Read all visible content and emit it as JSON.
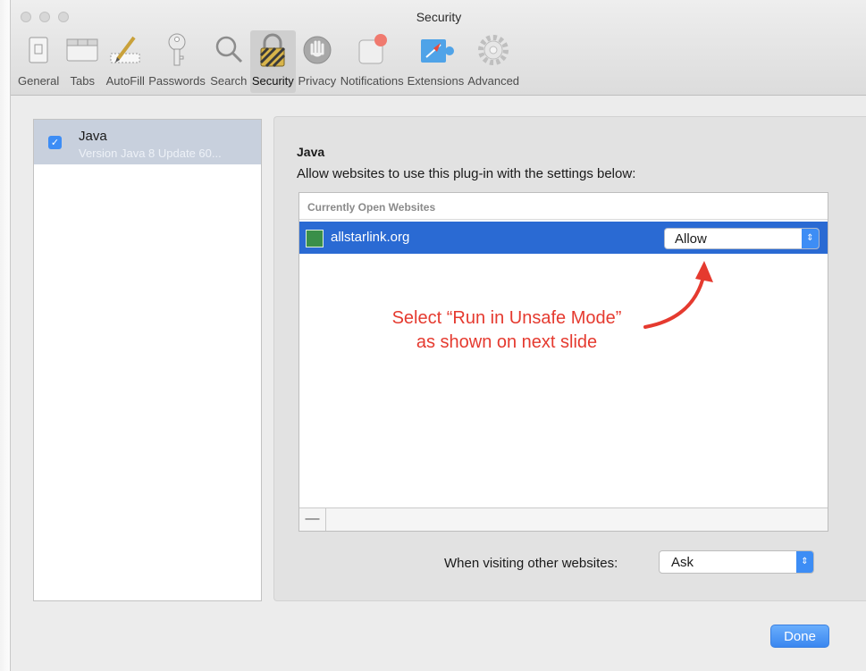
{
  "window": {
    "title": "Security"
  },
  "toolbar": {
    "tabs": [
      {
        "label": "General",
        "icon": "general-icon"
      },
      {
        "label": "Tabs",
        "icon": "tabs-icon"
      },
      {
        "label": "AutoFill",
        "icon": "autofill-icon"
      },
      {
        "label": "Passwords",
        "icon": "key-icon"
      },
      {
        "label": "Search",
        "icon": "search-icon"
      },
      {
        "label": "Security",
        "icon": "lock-icon",
        "active": true
      },
      {
        "label": "Privacy",
        "icon": "hand-icon"
      },
      {
        "label": "Notifications",
        "icon": "notifications-icon"
      },
      {
        "label": "Extensions",
        "icon": "puzzle-icon"
      },
      {
        "label": "Advanced",
        "icon": "gear-icon"
      }
    ]
  },
  "sidebar": {
    "plugin": {
      "name": "Java",
      "version": "Version Java 8 Update 60...",
      "checked": true
    }
  },
  "panel": {
    "title": "Java",
    "description": "Allow websites to use this plug-in with the settings below:",
    "table": {
      "header": "Currently Open Websites",
      "rows": [
        {
          "site": "allstarlink.org",
          "setting": "Allow"
        }
      ],
      "remove_label": "—"
    },
    "annotation": {
      "line1": "Select “Run in Unsafe Mode”",
      "line2": "as shown on next slide"
    },
    "other_websites": {
      "label": "When visiting other websites:",
      "value": "Ask"
    }
  },
  "footer": {
    "done_label": "Done"
  },
  "colors": {
    "accent": "#3d8df5",
    "selection": "#2a6ad3",
    "annotation": "#e53a2f"
  }
}
